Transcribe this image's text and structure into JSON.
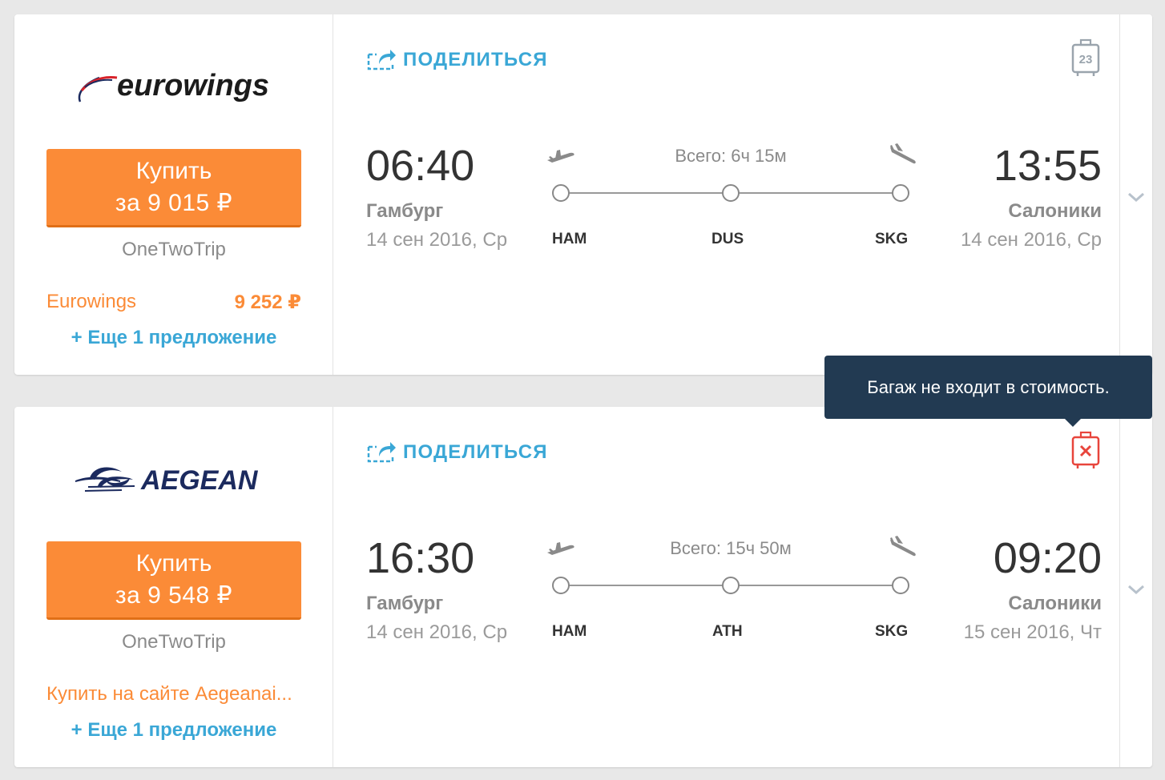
{
  "results": [
    {
      "airline": "eurowings",
      "buy_line1": "Купить",
      "buy_line2": "за 9 015 ₽",
      "agency": "OneTwoTrip",
      "alt_offer_name": "Eurowings",
      "alt_offer_price": "9 252 ₽",
      "more_offers": "+ Еще 1 предложение",
      "share_label": "ПОДЕЛИТЬСЯ",
      "baggage_allowance": "23",
      "departure": {
        "time": "06:40",
        "city": "Гамбург",
        "date": "14 сен 2016, Ср"
      },
      "arrival": {
        "time": "13:55",
        "city": "Салоники",
        "date": "14 сен 2016, Ср"
      },
      "total_duration": "Всего: 6ч 15м",
      "stops": [
        "HAM",
        "DUS",
        "SKG"
      ]
    },
    {
      "airline": "AEGEAN",
      "buy_line1": "Купить",
      "buy_line2": "за 9 548 ₽",
      "agency": "OneTwoTrip",
      "alt_offer_text": "Купить на сайте Aegeanai...",
      "more_offers": "+ Еще 1 предложение",
      "share_label": "ПОДЕЛИТЬСЯ",
      "departure": {
        "time": "16:30",
        "city": "Гамбург",
        "date": "14 сен 2016, Ср"
      },
      "arrival": {
        "time": "09:20",
        "city": "Салоники",
        "date": "15 сен 2016, Чт"
      },
      "total_duration": "Всего: 15ч 50м",
      "stops": [
        "HAM",
        "ATH",
        "SKG"
      ]
    }
  ],
  "tooltip": {
    "text": "Багаж не входит в стоимость."
  },
  "colors": {
    "accent_orange": "#fb8b37",
    "link_blue": "#3aa7d6",
    "tooltip_bg": "#223a52",
    "no_baggage_red": "#e8453c",
    "eurowings_navy": "#1b2a5e",
    "eurowings_red": "#d8232a"
  },
  "icons": [
    "share-icon",
    "baggage-icon",
    "no-baggage-icon",
    "plane-takeoff-icon",
    "plane-landing-icon",
    "chevron-down-icon"
  ]
}
